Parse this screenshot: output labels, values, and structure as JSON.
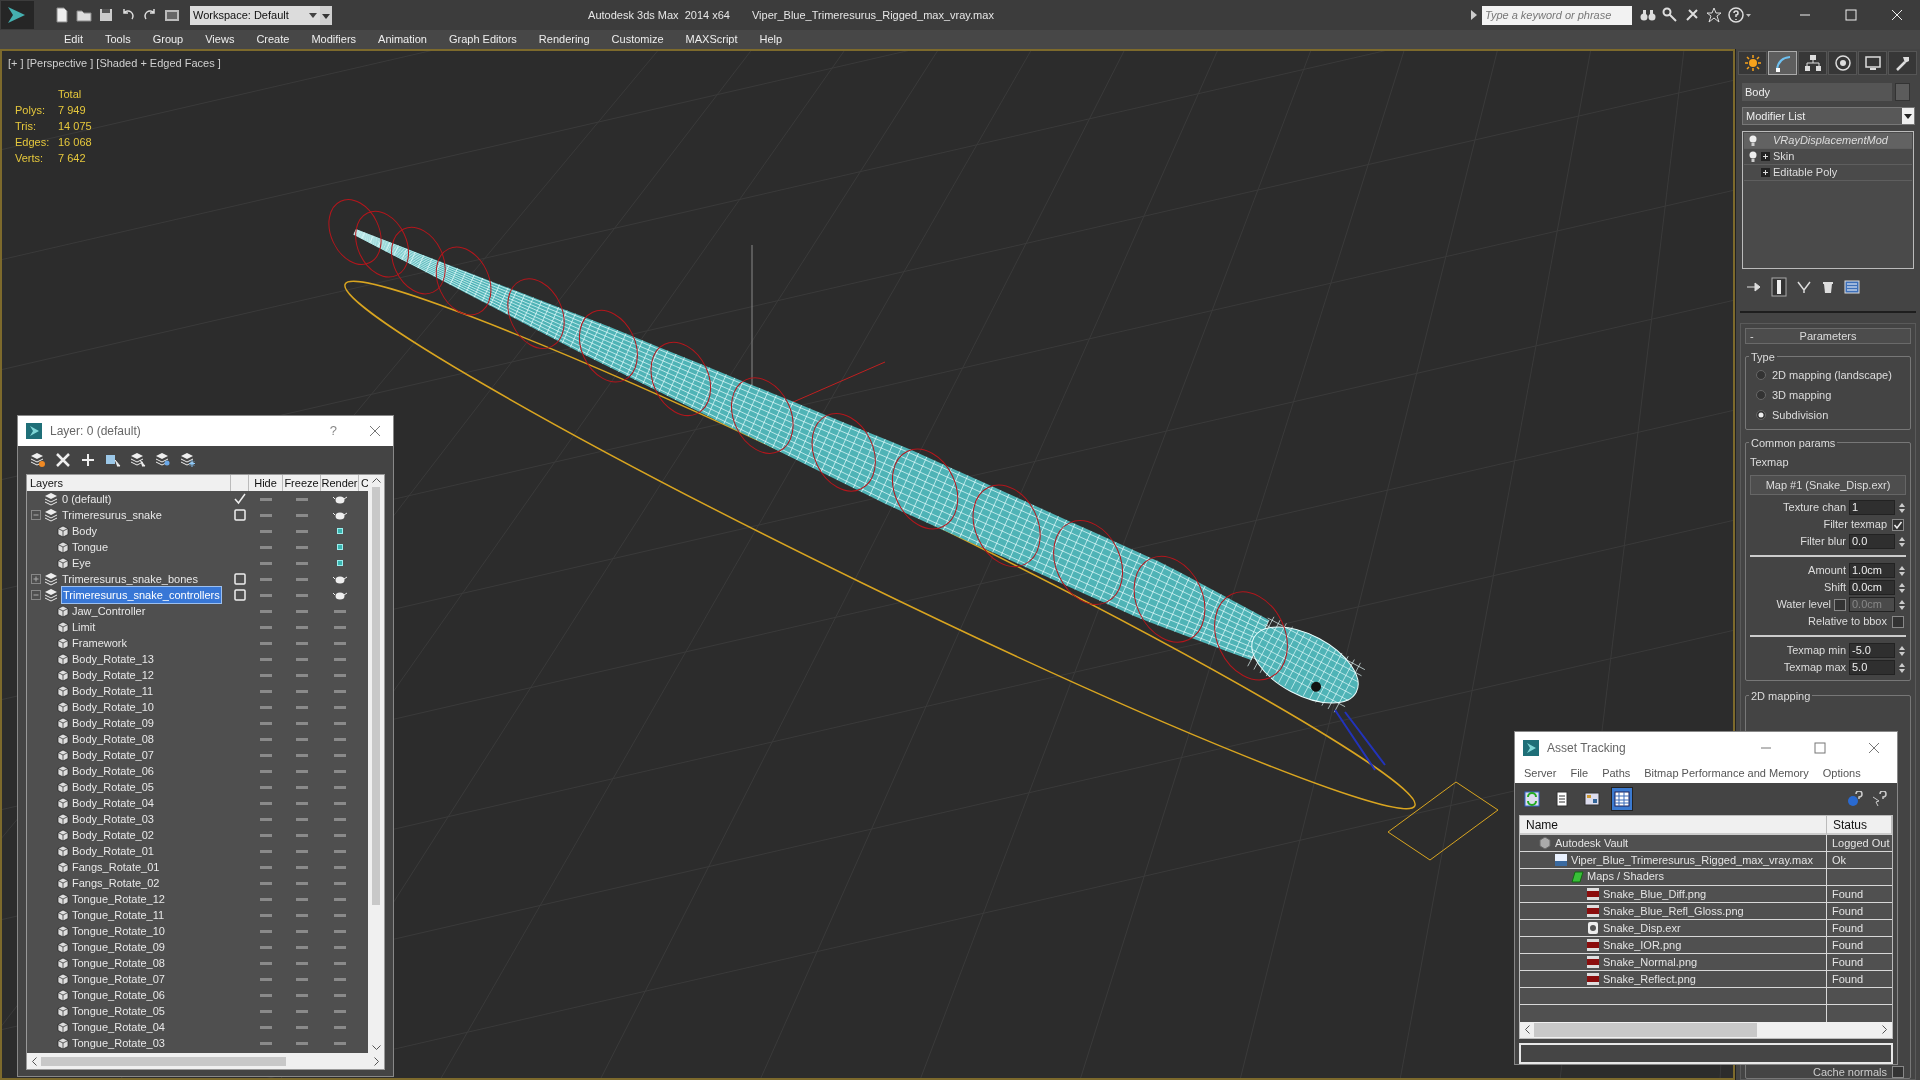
{
  "title_bar": {
    "workspace": "Workspace: Default",
    "app_title": "Autodesk 3ds Max  2014 x64",
    "file_name": "Viper_Blue_Trimeresurus_Rigged_max_vray.max",
    "search_placeholder": "Type a keyword or phrase"
  },
  "menu": [
    "Edit",
    "Tools",
    "Group",
    "Views",
    "Create",
    "Modifiers",
    "Animation",
    "Graph Editors",
    "Rendering",
    "Customize",
    "MAXScript",
    "Help"
  ],
  "viewport": {
    "label": "[+ ] [Perspective ] [Shaded + Edged Faces ]",
    "stats_header": "Total",
    "stats": [
      {
        "label": "Polys:",
        "value": "7 949"
      },
      {
        "label": "Tris:",
        "value": "14 075"
      },
      {
        "label": "Edges:",
        "value": "16 068"
      },
      {
        "label": "Verts:",
        "value": "7 642"
      }
    ]
  },
  "layer_dialog": {
    "title": "Layer: 0 (default)",
    "help": "?",
    "columns": [
      "Layers",
      "Hide",
      "Freeze",
      "Render",
      "C"
    ],
    "layers": [
      {
        "name": "0 (default)",
        "current": true,
        "selected": false
      },
      {
        "name": "Trimeresurus_snake",
        "current": false,
        "selected": false,
        "expanded": true,
        "children": [
          {
            "name": "Body",
            "renderable": true
          },
          {
            "name": "Tongue",
            "renderable": true
          },
          {
            "name": "Eye",
            "renderable": true
          }
        ]
      },
      {
        "name": "Trimeresurus_snake_bones",
        "current": false,
        "selected": false,
        "expanded": false
      },
      {
        "name": "Trimeresurus_snake_controllers",
        "current": false,
        "selected": true,
        "expanded": true,
        "children": [
          {
            "name": "Jaw_Controller",
            "renderable": false
          },
          {
            "name": "Limit",
            "renderable": false
          },
          {
            "name": "Framework",
            "renderable": false
          },
          {
            "name": "Body_Rotate_13",
            "renderable": false
          },
          {
            "name": "Body_Rotate_12",
            "renderable": false
          },
          {
            "name": "Body_Rotate_11",
            "renderable": false
          },
          {
            "name": "Body_Rotate_10",
            "renderable": false
          },
          {
            "name": "Body_Rotate_09",
            "renderable": false
          },
          {
            "name": "Body_Rotate_08",
            "renderable": false
          },
          {
            "name": "Body_Rotate_07",
            "renderable": false
          },
          {
            "name": "Body_Rotate_06",
            "renderable": false
          },
          {
            "name": "Body_Rotate_05",
            "renderable": false
          },
          {
            "name": "Body_Rotate_04",
            "renderable": false
          },
          {
            "name": "Body_Rotate_03",
            "renderable": false
          },
          {
            "name": "Body_Rotate_02",
            "renderable": false
          },
          {
            "name": "Body_Rotate_01",
            "renderable": false
          },
          {
            "name": "Fangs_Rotate_01",
            "renderable": false
          },
          {
            "name": "Fangs_Rotate_02",
            "renderable": false
          },
          {
            "name": "Tongue_Rotate_12",
            "renderable": false
          },
          {
            "name": "Tongue_Rotate_11",
            "renderable": false
          },
          {
            "name": "Tongue_Rotate_10",
            "renderable": false
          },
          {
            "name": "Tongue_Rotate_09",
            "renderable": false
          },
          {
            "name": "Tongue_Rotate_08",
            "renderable": false
          },
          {
            "name": "Tongue_Rotate_07",
            "renderable": false
          },
          {
            "name": "Tongue_Rotate_06",
            "renderable": false
          },
          {
            "name": "Tongue_Rotate_05",
            "renderable": false
          },
          {
            "name": "Tongue_Rotate_04",
            "renderable": false
          },
          {
            "name": "Tongue_Rotate_03",
            "renderable": false
          }
        ]
      }
    ]
  },
  "command_panel": {
    "tabs": [
      {
        "kind": "create",
        "selected": false
      },
      {
        "kind": "modify",
        "selected": true
      },
      {
        "kind": "hierarchy",
        "selected": false
      },
      {
        "kind": "motion",
        "selected": false
      },
      {
        "kind": "display",
        "selected": false
      },
      {
        "kind": "utilities",
        "selected": false
      }
    ],
    "object_name": "Body",
    "modifier_list": "Modifier List",
    "stack": [
      {
        "name": "VRayDisplacementMod",
        "selected": true,
        "bulb": true,
        "expander": false
      },
      {
        "name": "Skin",
        "selected": false,
        "bulb": true,
        "expander": true
      },
      {
        "name": "Editable Poly",
        "selected": false,
        "bulb": false,
        "expander": true
      }
    ],
    "rollout": {
      "toggle": "-",
      "title": "Parameters"
    },
    "type_group": {
      "label": "Type",
      "options": [
        {
          "label": "2D mapping (landscape)",
          "selected": false
        },
        {
          "label": "3D mapping",
          "selected": false
        },
        {
          "label": "Subdivision",
          "selected": true
        }
      ]
    },
    "common_group": {
      "label": "Common params",
      "rows": [
        {
          "kind": "label",
          "label": "Texmap"
        },
        {
          "kind": "map_button",
          "label": "Map #1 (Snake_Disp.exr)"
        },
        {
          "kind": "spinner",
          "label": "Texture chan",
          "value": "1",
          "disabled": false
        },
        {
          "kind": "checkbox",
          "label": "Filter texmap",
          "checked": true
        },
        {
          "kind": "spinner",
          "label": "Filter blur",
          "value": "0.0",
          "disabled": false
        },
        {
          "kind": "divider"
        },
        {
          "kind": "spinner",
          "label": "Amount",
          "value": "1.0cm",
          "disabled": false
        },
        {
          "kind": "spinner",
          "label": "Shift",
          "value": "0.0cm",
          "disabled": false
        },
        {
          "kind": "check_spinner",
          "label": "Water level",
          "value": "0.0cm",
          "checked": false,
          "disabled": true
        },
        {
          "kind": "checkbox",
          "label": "Relative to bbox",
          "checked": false
        },
        {
          "kind": "divider"
        },
        {
          "kind": "spinner",
          "label": "Texmap min",
          "value": "-5.0",
          "disabled": false
        },
        {
          "kind": "spinner",
          "label": "Texmap max",
          "value": "5.0",
          "disabled": false
        }
      ]
    },
    "next_group": "2D mapping",
    "cache_normals": {
      "label": "Cache normals",
      "checked": false
    }
  },
  "asset_tracking": {
    "title": "Asset Tracking",
    "menu": [
      "Server",
      "File",
      "Paths",
      "Bitmap Performance and Memory",
      "Options"
    ],
    "view_buttons": [
      {
        "kind": "refresh",
        "selected": false
      },
      {
        "kind": "list",
        "selected": false
      },
      {
        "kind": "thumbnails",
        "selected": false
      },
      {
        "kind": "table",
        "selected": true
      }
    ],
    "columns": [
      "Name",
      "Status"
    ],
    "assets": [
      {
        "kind": "vault",
        "name": "Autodesk Vault",
        "status": "Logged Out",
        "children": [
          {
            "kind": "max",
            "name": "Viper_Blue_Trimeresurus_Rigged_max_vray.max",
            "status": "Ok",
            "children": [
              {
                "kind": "folder",
                "name": "Maps / Shaders",
                "children": [
                  {
                    "kind": "png",
                    "name": "Snake_Blue_Diff.png",
                    "status": "Found"
                  },
                  {
                    "kind": "png",
                    "name": "Snake_Blue_Refl_Gloss.png",
                    "status": "Found"
                  },
                  {
                    "kind": "exr",
                    "name": "Snake_Disp.exr",
                    "status": "Found"
                  },
                  {
                    "kind": "png",
                    "name": "Snake_IOR.png",
                    "status": "Found"
                  },
                  {
                    "kind": "png",
                    "name": "Snake_Normal.png",
                    "status": "Found"
                  },
                  {
                    "kind": "png",
                    "name": "Snake_Reflect.png",
                    "status": "Found"
                  }
                ]
              }
            ]
          }
        ]
      }
    ]
  }
}
